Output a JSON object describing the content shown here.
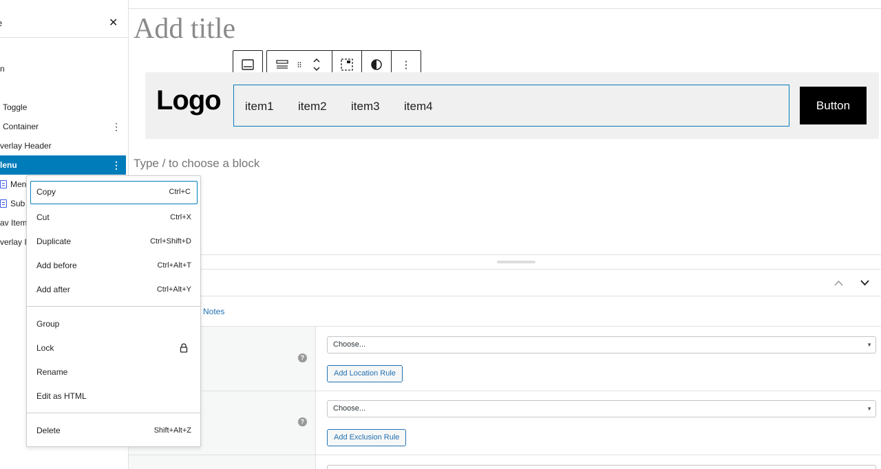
{
  "list_view": {
    "title": "e",
    "items": [
      {
        "label": "n"
      },
      {
        "label": "Toggle"
      },
      {
        "label": "Container"
      },
      {
        "label": "verlay Header"
      },
      {
        "label": "lenu"
      },
      {
        "label": "Menu"
      },
      {
        "label": "Sub I"
      },
      {
        "label": "av Item"
      },
      {
        "label": "verlay It"
      }
    ]
  },
  "editor": {
    "title_placeholder": "Add title",
    "block_placeholder": "Type / to choose a block",
    "header_block": {
      "logo_text": "Logo",
      "nav_items": [
        "item1",
        "item2",
        "item3",
        "item4"
      ],
      "button_label": "Button"
    }
  },
  "meta": {
    "notes_link": "Notes",
    "location_select": "Choose...",
    "location_button": "Add Location Rule",
    "exclusion_select": "Choose...",
    "exclusion_button": "Add Exclusion Rule",
    "help_glyph": "?"
  },
  "context_menu": {
    "copy": {
      "label": "Copy",
      "shortcut": "Ctrl+C"
    },
    "cut": {
      "label": "Cut",
      "shortcut": "Ctrl+X"
    },
    "duplicate": {
      "label": "Duplicate",
      "shortcut": "Ctrl+Shift+D"
    },
    "add_before": {
      "label": "Add before",
      "shortcut": "Ctrl+Alt+T"
    },
    "add_after": {
      "label": "Add after",
      "shortcut": "Ctrl+Alt+Y"
    },
    "group": {
      "label": "Group"
    },
    "lock": {
      "label": "Lock"
    },
    "rename": {
      "label": "Rename"
    },
    "edit_html": {
      "label": "Edit as HTML"
    },
    "delete": {
      "label": "Delete",
      "shortcut": "Shift+Alt+Z"
    }
  },
  "colors": {
    "accent": "#007cba",
    "link": "#2271b1",
    "header_band": "#f0f0f0",
    "button_bg": "#000000"
  }
}
